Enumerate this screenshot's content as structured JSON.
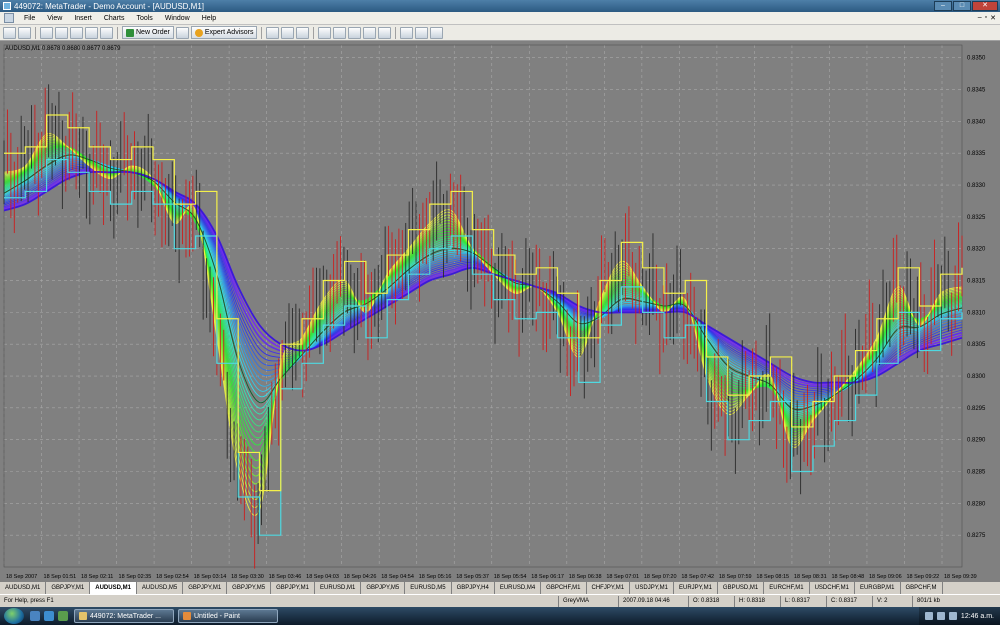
{
  "window": {
    "title": "449072: MetaTrader - Demo Account - [AUDUSD,M1]"
  },
  "menu": [
    "File",
    "View",
    "Insert",
    "Charts",
    "Tools",
    "Window",
    "Help"
  ],
  "toolbar": {
    "new_order_label": "New Order",
    "expert_advisors_label": "Expert Advisors"
  },
  "chart": {
    "symbol_header": "AUDUSD,M1  0.8678 0.8680 0.8677 0.8679",
    "background_color": "#808080",
    "grid_color": "#a8a8a8",
    "time_labels": [
      "18 Sep 2007",
      "18 Sep 01:51",
      "18 Sep 02:11",
      "18 Sep 02:35",
      "18 Sep 02:54",
      "18 Sep 03:14",
      "18 Sep 03:30",
      "18 Sep 03:46",
      "18 Sep 04:03",
      "18 Sep 04:26",
      "18 Sep 04:54",
      "18 Sep 05:16",
      "18 Sep 05:37",
      "18 Sep 05:54",
      "18 Sep 06:17",
      "18 Sep 06:38",
      "18 Sep 07:01",
      "18 Sep 07:20",
      "18 Sep 07:42",
      "18 Sep 07:59",
      "18 Sep 08:15",
      "18 Sep 08:31",
      "18 Sep 08:48",
      "18 Sep 09:06",
      "18 Sep 09:22",
      "18 Sep 09:39"
    ]
  },
  "chart_data": {
    "type": "line",
    "title": "",
    "ylim": [
      0.827,
      0.8352
    ],
    "y_ticks": [
      "0.8350",
      "0.8345",
      "0.8340",
      "0.8335",
      "0.8330",
      "0.8325",
      "0.8320",
      "0.8315",
      "0.8310",
      "0.8305",
      "0.8300",
      "0.8295",
      "0.8290",
      "0.8285",
      "0.8280",
      "0.8275"
    ],
    "series": [
      {
        "values": [
          0.8332,
          0.8333,
          0.8338,
          0.8336,
          0.8333,
          0.8331,
          0.8333,
          0.8331,
          0.8324,
          0.8326,
          0.8306,
          0.8285,
          0.8279,
          0.8302,
          0.8306,
          0.8312,
          0.8315,
          0.831,
          0.8316,
          0.832,
          0.8324,
          0.8326,
          0.832,
          0.8316,
          0.8313,
          0.8314,
          0.831,
          0.8303,
          0.8312,
          0.8318,
          0.8314,
          0.831,
          0.8312,
          0.83,
          0.8294,
          0.8297,
          0.83,
          0.8289,
          0.8293,
          0.8297,
          0.8301,
          0.8306,
          0.8314,
          0.8308,
          0.8313,
          0.8314
        ]
      },
      {
        "values": [
          0.833,
          0.8332,
          0.8335,
          0.8336,
          0.8334,
          0.8332,
          0.8332,
          0.833,
          0.8326,
          0.8324,
          0.8312,
          0.8296,
          0.829,
          0.8299,
          0.8304,
          0.8309,
          0.8312,
          0.8312,
          0.8315,
          0.8318,
          0.8321,
          0.8322,
          0.832,
          0.8317,
          0.8314,
          0.8314,
          0.8311,
          0.8307,
          0.831,
          0.8314,
          0.8313,
          0.8311,
          0.8311,
          0.8304,
          0.8299,
          0.8298,
          0.8298,
          0.8293,
          0.8294,
          0.8297,
          0.83,
          0.8304,
          0.831,
          0.8309,
          0.8311,
          0.8312
        ]
      },
      {
        "values": [
          0.8328,
          0.833,
          0.8332,
          0.8334,
          0.8334,
          0.8333,
          0.8332,
          0.8331,
          0.8328,
          0.8325,
          0.8318,
          0.8306,
          0.8299,
          0.83,
          0.8303,
          0.8306,
          0.8309,
          0.8311,
          0.8313,
          0.8316,
          0.8318,
          0.8319,
          0.8319,
          0.8317,
          0.8315,
          0.8314,
          0.8312,
          0.8309,
          0.8309,
          0.8311,
          0.8311,
          0.8311,
          0.8311,
          0.8307,
          0.8303,
          0.8301,
          0.8299,
          0.8296,
          0.8296,
          0.8297,
          0.8299,
          0.8302,
          0.8306,
          0.8307,
          0.8309,
          0.831
        ]
      },
      {
        "values": [
          0.8326,
          0.8327,
          0.8329,
          0.8331,
          0.8332,
          0.8332,
          0.8332,
          0.8331,
          0.8329,
          0.8327,
          0.8322,
          0.8314,
          0.8308,
          0.8305,
          0.8304,
          0.8305,
          0.8307,
          0.8309,
          0.8311,
          0.8313,
          0.8315,
          0.8316,
          0.8317,
          0.8316,
          0.8315,
          0.8314,
          0.8313,
          0.8311,
          0.831,
          0.831,
          0.831,
          0.831,
          0.831,
          0.8308,
          0.8306,
          0.8304,
          0.8302,
          0.83,
          0.8299,
          0.8299,
          0.8299,
          0.83,
          0.8302,
          0.8304,
          0.8305,
          0.8306
        ]
      }
    ]
  },
  "tabs": [
    "AUDUSD,M1",
    "GBPJPY,M1",
    "AUDUSD,M1",
    "AUDUSD,M5",
    "GBPJPY,M1",
    "GBPJPY,M5",
    "GBPJPY,M1",
    "EURUSD,M1",
    "GBPJPY,M5",
    "EURUSD,M5",
    "GBPJPY,H4",
    "EURUSD,M4",
    "GBPCHF,M1",
    "CHFJPY,M1",
    "USDJPY,M1",
    "EURJPY,M1",
    "GBPUSD,M1",
    "EURCHF,M1",
    "USDCHF,M1",
    "EURGBP,M1",
    "GBPCHF,M"
  ],
  "active_tab_index": 2,
  "status": {
    "help": "For Help, press F1",
    "profile": "GreyVMA",
    "datetime": "2007.09.18 04:46",
    "open": "O: 0.8318",
    "high": "H: 0.8318",
    "low": "L: 0.8317",
    "close": "C: 0.8317",
    "volume": "V: 2",
    "traffic": "801/1 kb"
  },
  "taskbar": {
    "items": [
      "449072: MetaTrader ...",
      "Untitled - Paint"
    ],
    "clock": "12:46 a.m."
  }
}
